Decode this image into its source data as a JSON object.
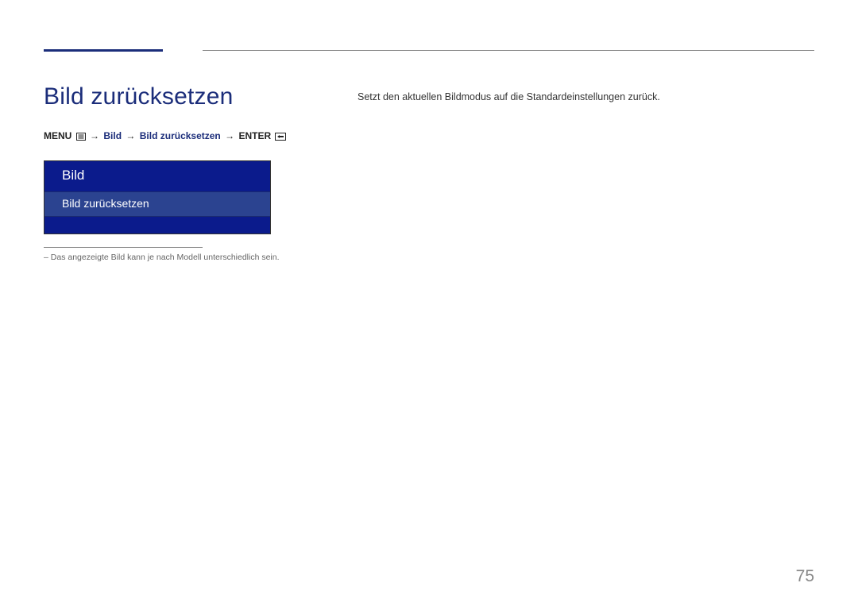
{
  "heading": "Bild zurücksetzen",
  "navpath": {
    "menu_label": "MENU",
    "step1": "Bild",
    "step2": "Bild zurücksetzen",
    "enter_label": "ENTER"
  },
  "menu_preview": {
    "header": "Bild",
    "item": "Bild zurücksetzen"
  },
  "footnote_prefix": "–  ",
  "footnote": "Das angezeigte Bild kann je nach Modell unterschiedlich sein.",
  "description": "Setzt den aktuellen Bildmodus auf die Standardeinstellungen zurück.",
  "page_number": "75"
}
